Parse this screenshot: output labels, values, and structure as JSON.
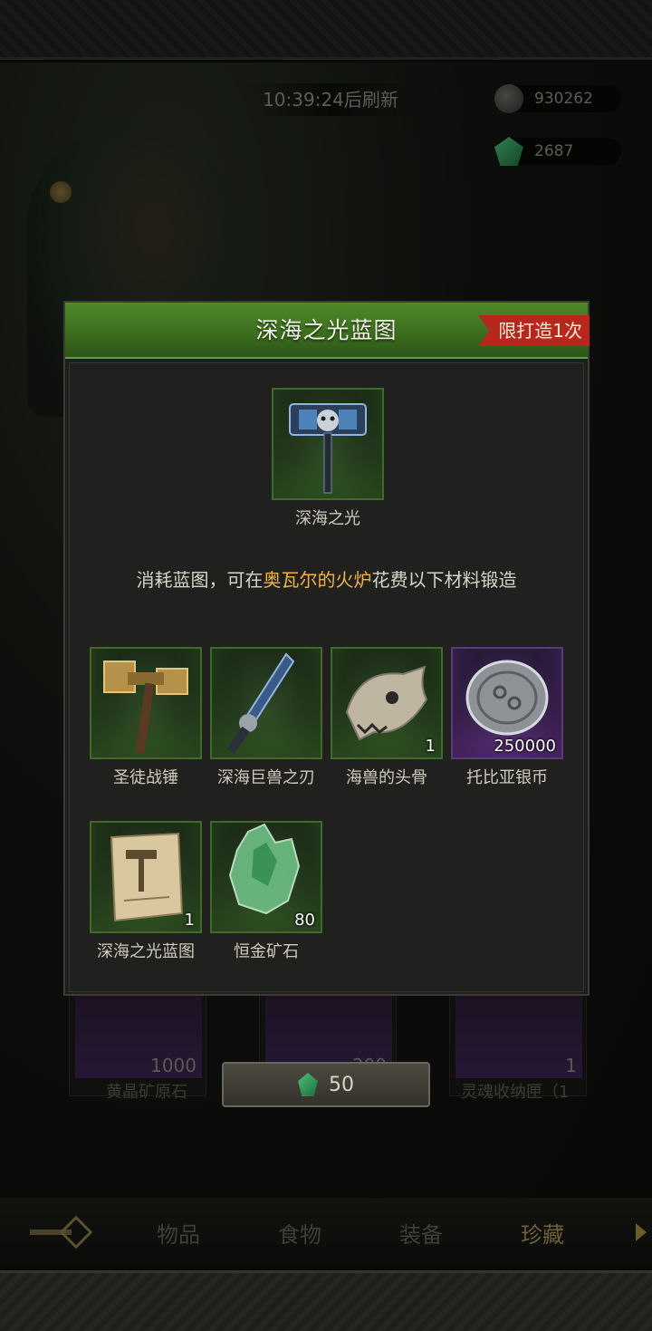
{
  "shop": {
    "refresh_timer": "10:39:24后刷新",
    "currencies": [
      {
        "icon": "silver-coin-icon",
        "value": "930262"
      },
      {
        "icon": "green-gem-icon",
        "value": "2687"
      }
    ],
    "background_items": [
      {
        "qty": "1000",
        "name": "黄晶矿原石"
      },
      {
        "qty": "200",
        "name": ""
      },
      {
        "qty": "1",
        "name": "灵魂收纳匣（1"
      }
    ],
    "price": {
      "icon": "green-gem-icon",
      "value": "50"
    },
    "tabs": [
      "物品",
      "食物",
      "装备",
      "珍藏"
    ],
    "active_tab": "珍藏"
  },
  "modal": {
    "title": "深海之光蓝图",
    "limit_badge": "限打造1次",
    "product": {
      "name": "深海之光",
      "icon": "war-hammer-icon"
    },
    "instruction": {
      "prefix": "消耗蓝图，可在",
      "highlight": "奥瓦尔的火炉",
      "suffix": "花费以下材料锻造"
    },
    "materials": [
      {
        "name": "圣徒战锤",
        "qty": "",
        "rarity": "green",
        "icon": "golden-hammer-icon"
      },
      {
        "name": "深海巨兽之刃",
        "qty": "",
        "rarity": "green",
        "icon": "sword-icon"
      },
      {
        "name": "海兽的头骨",
        "qty": "1",
        "rarity": "green",
        "icon": "skull-icon"
      },
      {
        "name": "托比亚银币",
        "qty": "250000",
        "rarity": "purple",
        "icon": "silver-coin-icon"
      },
      {
        "name": "深海之光蓝图",
        "qty": "1",
        "rarity": "green",
        "icon": "scroll-icon"
      },
      {
        "name": "恒金矿石",
        "qty": "80",
        "rarity": "green",
        "icon": "ore-crystal-icon"
      }
    ]
  },
  "colors": {
    "header_green": "#3c6f1f",
    "badge_red": "#b8271d",
    "highlight": "#f0b443"
  }
}
